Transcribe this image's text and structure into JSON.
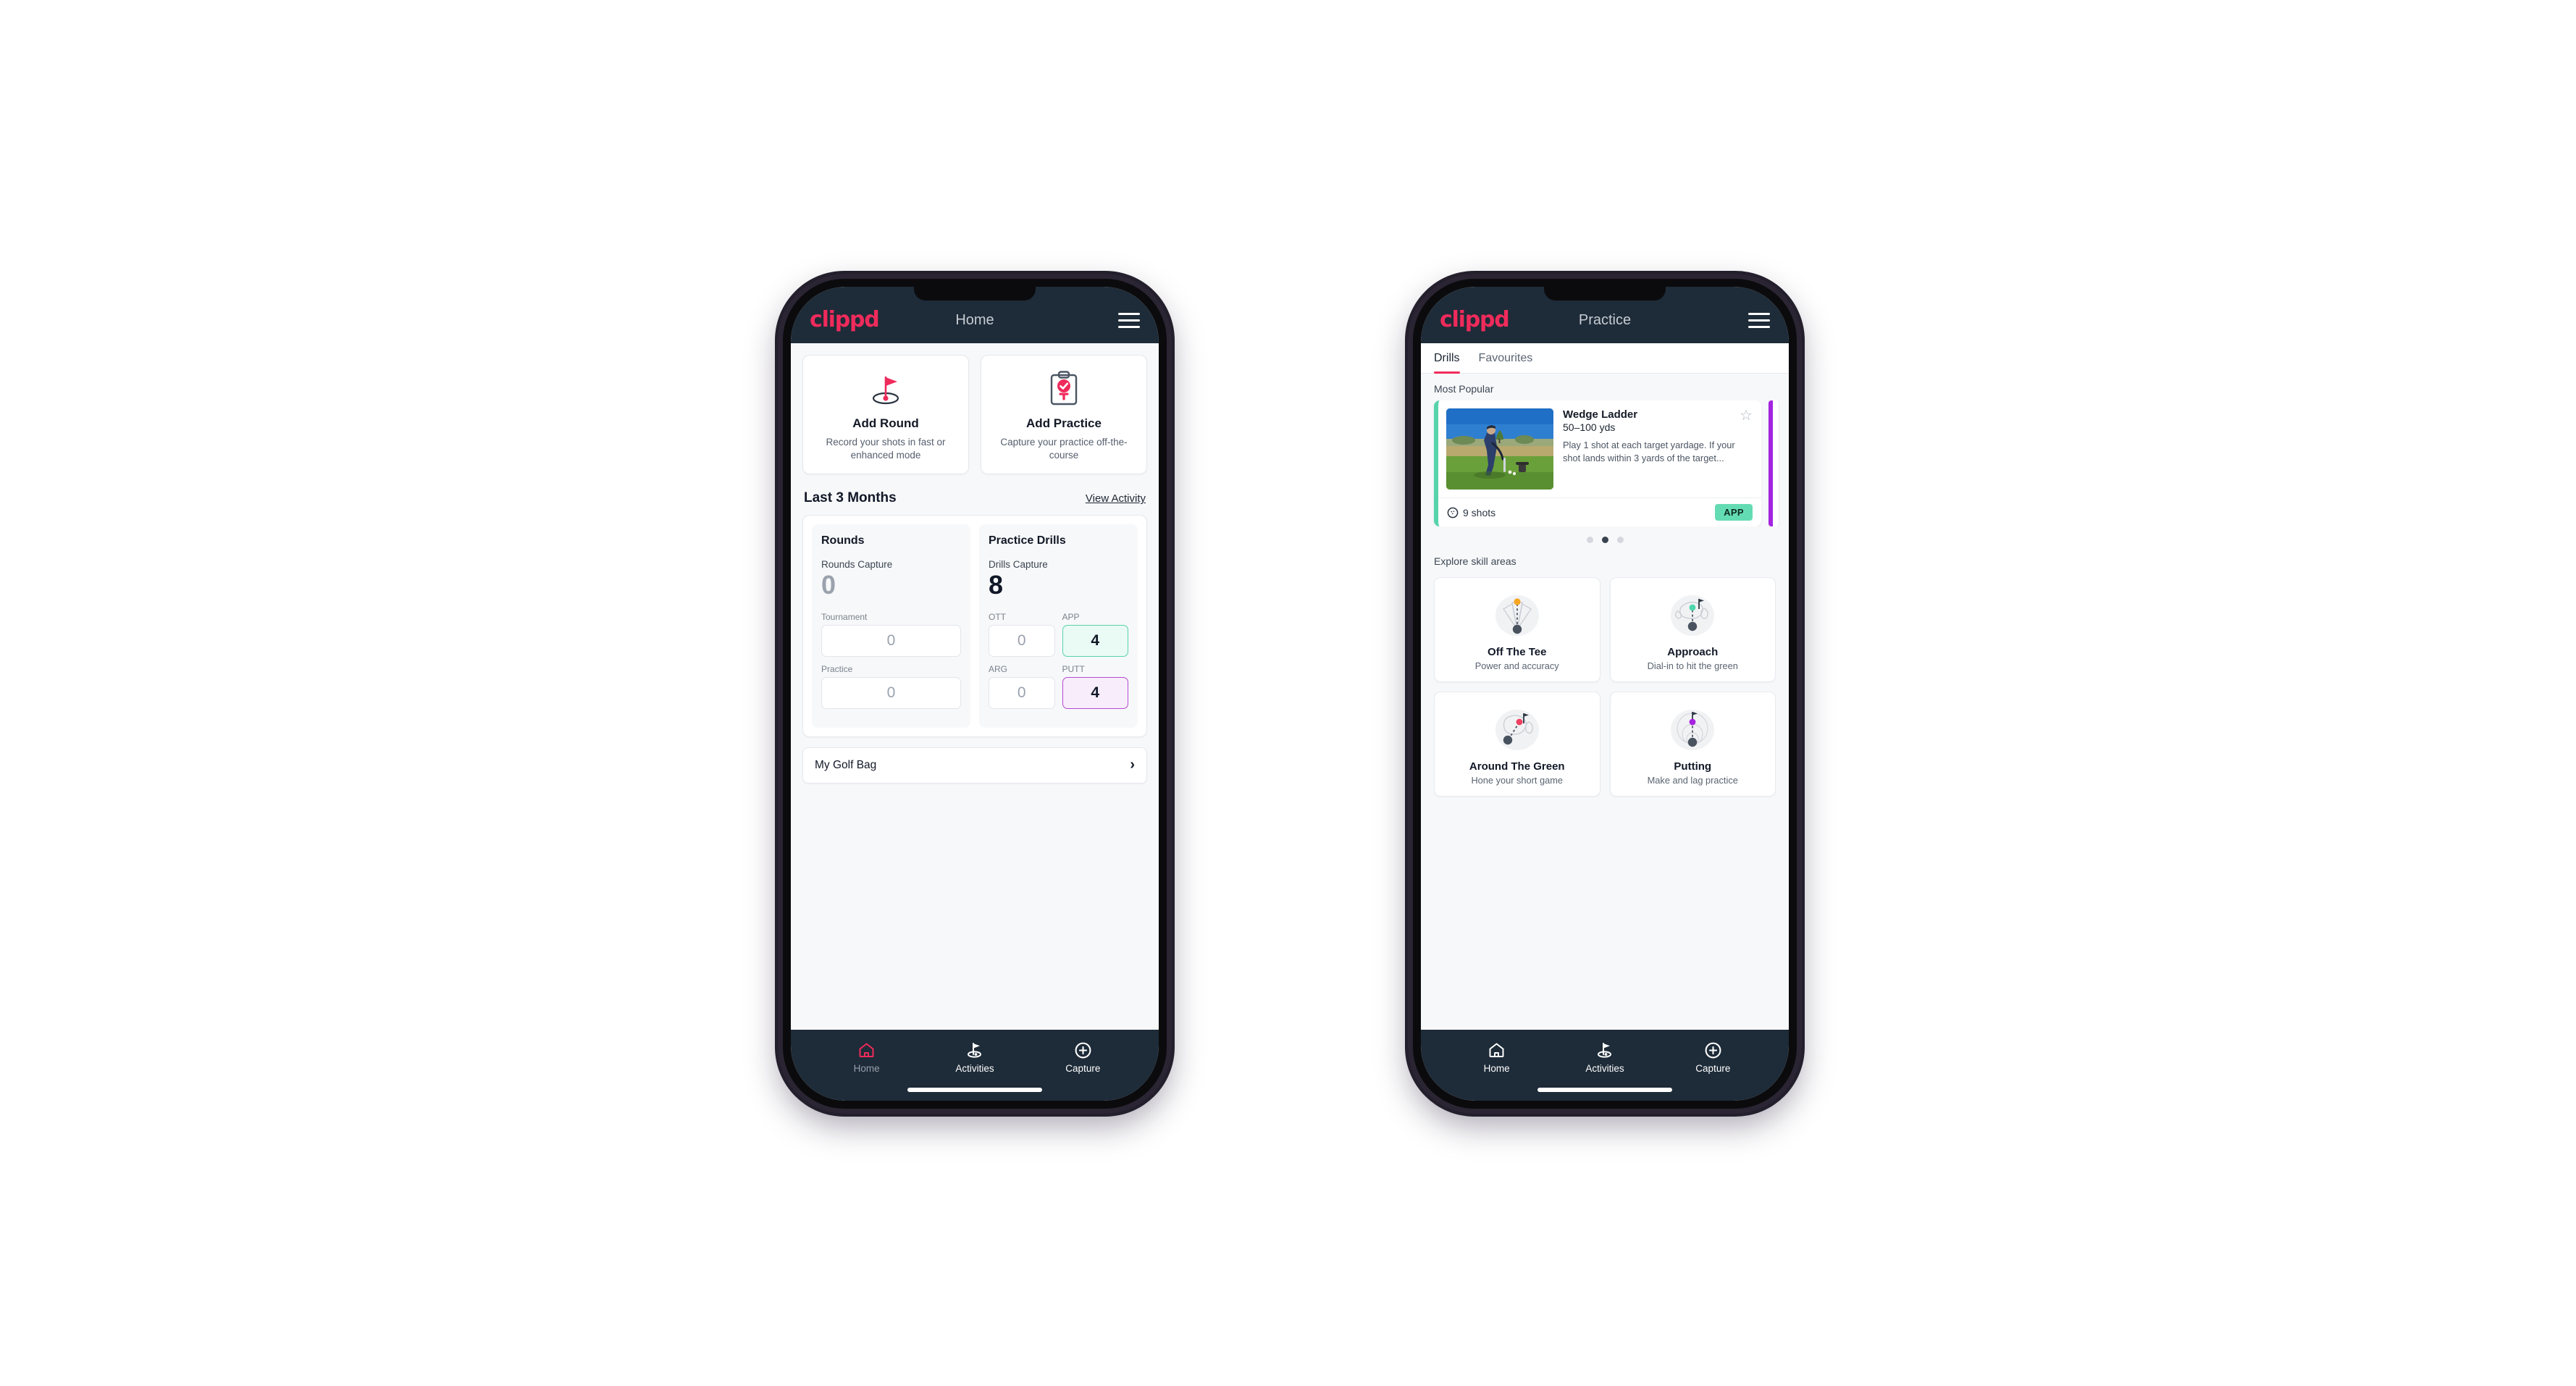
{
  "brand": {
    "logo_text": "clippd",
    "accent": "#ef2b5b",
    "navbar_bg": "#1e2b38"
  },
  "phone_home": {
    "appbar": {
      "title": "Home",
      "menu_icon": "hamburger-icon"
    },
    "quick_actions": [
      {
        "icon": "golf-flag-hole-icon",
        "title": "Add Round",
        "subtitle": "Record your shots in fast or enhanced mode"
      },
      {
        "icon": "clipboard-check-tee-icon",
        "title": "Add Practice",
        "subtitle": "Capture your practice off-the-course"
      }
    ],
    "section": {
      "title": "Last 3 Months",
      "link": "View Activity"
    },
    "rounds": {
      "heading": "Rounds",
      "capture_label": "Rounds Capture",
      "capture_value": "0",
      "metrics": [
        {
          "label": "Tournament",
          "value": "0",
          "state": "empty"
        },
        {
          "label": "Practice",
          "value": "0",
          "state": "empty"
        }
      ]
    },
    "drills": {
      "heading": "Practice Drills",
      "capture_label": "Drills Capture",
      "capture_value": "8",
      "metrics": [
        {
          "label": "OTT",
          "value": "0",
          "state": "empty"
        },
        {
          "label": "APP",
          "value": "4",
          "state": "app"
        },
        {
          "label": "ARG",
          "value": "0",
          "state": "empty"
        },
        {
          "label": "PUTT",
          "value": "4",
          "state": "putt"
        }
      ]
    },
    "golf_bag": {
      "label": "My Golf Bag",
      "chevron": "chevron-right-icon"
    },
    "bottom_nav": [
      {
        "icon": "home-icon",
        "label": "Home",
        "active": true
      },
      {
        "icon": "golf-flag-icon",
        "label": "Activities",
        "active": false
      },
      {
        "icon": "plus-circle-icon",
        "label": "Capture",
        "active": false
      }
    ]
  },
  "phone_practice": {
    "appbar": {
      "title": "Practice",
      "menu_icon": "hamburger-icon"
    },
    "tabs": [
      {
        "label": "Drills",
        "active": true
      },
      {
        "label": "Favourites",
        "active": false
      }
    ],
    "most_popular_label": "Most Popular",
    "drill": {
      "name": "Wedge Ladder",
      "yardage": "50–100 yds",
      "description": "Play 1 shot at each target yardage. If your shot lands within 3 yards of the target...",
      "shots": "9 shots",
      "shots_icon": "golf-ball-icon",
      "badge": "APP",
      "badge_color": "#64dcb3",
      "accent_color": "#57d3ac",
      "favourite_icon": "star-outline-icon",
      "thumbnail": "golfer-pitching-photo"
    },
    "next_card_accent": "#a524e0",
    "carousel_dots": {
      "count": 3,
      "active_index": 1
    },
    "explore_label": "Explore skill areas",
    "skill_areas": [
      {
        "icon": "tee-shot-fan-icon",
        "title": "Off The Tee",
        "subtitle": "Power and accuracy",
        "dot_color": "#f5a623"
      },
      {
        "icon": "approach-green-icon",
        "title": "Approach",
        "subtitle": "Dial-in to hit the green",
        "dot_color": "#4fd6ae"
      },
      {
        "icon": "chip-around-green-icon",
        "title": "Around The Green",
        "subtitle": "Hone your short game",
        "dot_color": "#ef4060"
      },
      {
        "icon": "putting-rings-icon",
        "title": "Putting",
        "subtitle": "Make and lag practice",
        "dot_color": "#a524e0"
      }
    ],
    "bottom_nav": [
      {
        "icon": "home-icon",
        "label": "Home",
        "active": false
      },
      {
        "icon": "golf-flag-icon",
        "label": "Activities",
        "active": true
      },
      {
        "icon": "plus-circle-icon",
        "label": "Capture",
        "active": false
      }
    ]
  }
}
